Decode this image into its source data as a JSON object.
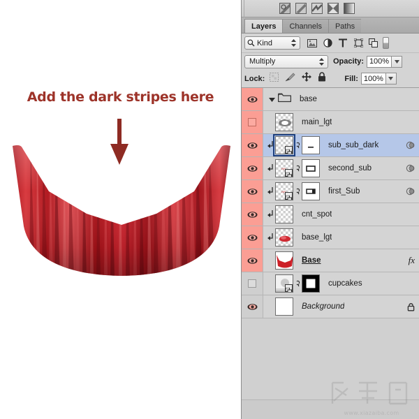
{
  "canvas": {
    "annotation": "Add the dark stripes here",
    "annotation_color": "#9d3329",
    "arrow_icon": "down-arrow-icon",
    "artwork_name": "cupcake-wrapper-artwork",
    "artwork_colors": {
      "base_red": "#c9222b",
      "highlight": "#e8565a",
      "shadow": "#7d1016",
      "deep": "#5e0c12"
    }
  },
  "panel": {
    "styles_strip": {
      "name": "styles-presets",
      "swatches": [
        "style-swatch-1",
        "style-swatch-2",
        "style-swatch-3",
        "style-swatch-4",
        "style-swatch-5"
      ]
    },
    "tabs": [
      {
        "label": "Layers",
        "active": true
      },
      {
        "label": "Channels",
        "active": false
      },
      {
        "label": "Paths",
        "active": false
      }
    ],
    "filter_row": {
      "search_icon": "magnifier-icon",
      "kind_label": "Kind",
      "stepper_icon": "stepper-updown-icon",
      "filter_icons": [
        "pixel-layer-filter-icon",
        "adjustment-layer-filter-icon",
        "type-layer-filter-icon",
        "shape-layer-filter-icon",
        "smart-object-filter-icon"
      ],
      "toggle_name": "filter-enable-toggle"
    },
    "blend_row": {
      "blend_mode": "Multiply",
      "opacity_label": "Opacity:",
      "opacity_value": "100%"
    },
    "lock_row": {
      "lock_label": "Lock:",
      "lock_icons": [
        "lock-transparent-pixels-icon",
        "lock-image-pixels-icon",
        "lock-position-icon",
        "lock-all-icon"
      ],
      "fill_label": "Fill:",
      "fill_value": "100%"
    },
    "layers": [
      {
        "name": "base",
        "type": "group",
        "visible": true,
        "expanded": true,
        "selected": false,
        "indent": 0,
        "clipped": false,
        "has_mask": false,
        "thumb": "folder",
        "right_icon": "",
        "style": "normal"
      },
      {
        "name": "main_lgt",
        "type": "pixel",
        "visible": false,
        "selected": false,
        "indent": 1,
        "clipped": false,
        "has_mask": false,
        "thumb": "checker-blob-white",
        "right_icon": "",
        "style": "normal"
      },
      {
        "name": "sub_sub_dark",
        "type": "pixel-smart",
        "visible": true,
        "selected": true,
        "indent": 1,
        "clipped": true,
        "has_mask": true,
        "thumb": "checker-empty-smart",
        "mask_glyph": "dash",
        "right_icon": "vector-mask-icon",
        "style": "normal"
      },
      {
        "name": "second_sub",
        "type": "pixel-smart",
        "visible": true,
        "selected": false,
        "indent": 1,
        "clipped": true,
        "has_mask": true,
        "thumb": "checker-faint-smart",
        "mask_glyph": "rect-outline",
        "right_icon": "vector-mask-icon",
        "style": "normal"
      },
      {
        "name": "first_Sub",
        "type": "pixel-smart",
        "visible": true,
        "selected": false,
        "indent": 1,
        "clipped": true,
        "has_mask": true,
        "thumb": "checker-faint-smart",
        "mask_glyph": "rect-filled",
        "right_icon": "vector-mask-icon",
        "style": "normal"
      },
      {
        "name": "cnt_spot",
        "type": "pixel",
        "visible": true,
        "selected": false,
        "indent": 1,
        "clipped": true,
        "has_mask": false,
        "thumb": "checker-empty",
        "right_icon": "",
        "style": "normal"
      },
      {
        "name": "base_lgt",
        "type": "pixel",
        "visible": true,
        "selected": false,
        "indent": 1,
        "clipped": true,
        "has_mask": false,
        "thumb": "checker-red-blob",
        "right_icon": "",
        "style": "normal"
      },
      {
        "name": "Base",
        "type": "shape",
        "visible": true,
        "selected": false,
        "indent": 0,
        "clipped": false,
        "has_mask": false,
        "thumb": "red-cup-shape",
        "right_icon": "fx",
        "right_icon_text": "fx",
        "style": "underline"
      },
      {
        "name": "cupcakes",
        "type": "smart-object",
        "visible": false,
        "selected": false,
        "indent": 0,
        "clipped": false,
        "has_mask": true,
        "thumb": "photo-smart-object",
        "mask_glyph": "black-mask-white-square",
        "right_icon": "",
        "style": "normal"
      },
      {
        "name": "Background",
        "type": "background",
        "visible": true,
        "selected": false,
        "indent": 0,
        "clipped": false,
        "has_mask": false,
        "thumb": "white",
        "right_icon": "padlock-icon",
        "style": "italic"
      }
    ]
  },
  "watermark": {
    "logo_text": "下载吧",
    "url": "www.xiazaiba.com"
  }
}
